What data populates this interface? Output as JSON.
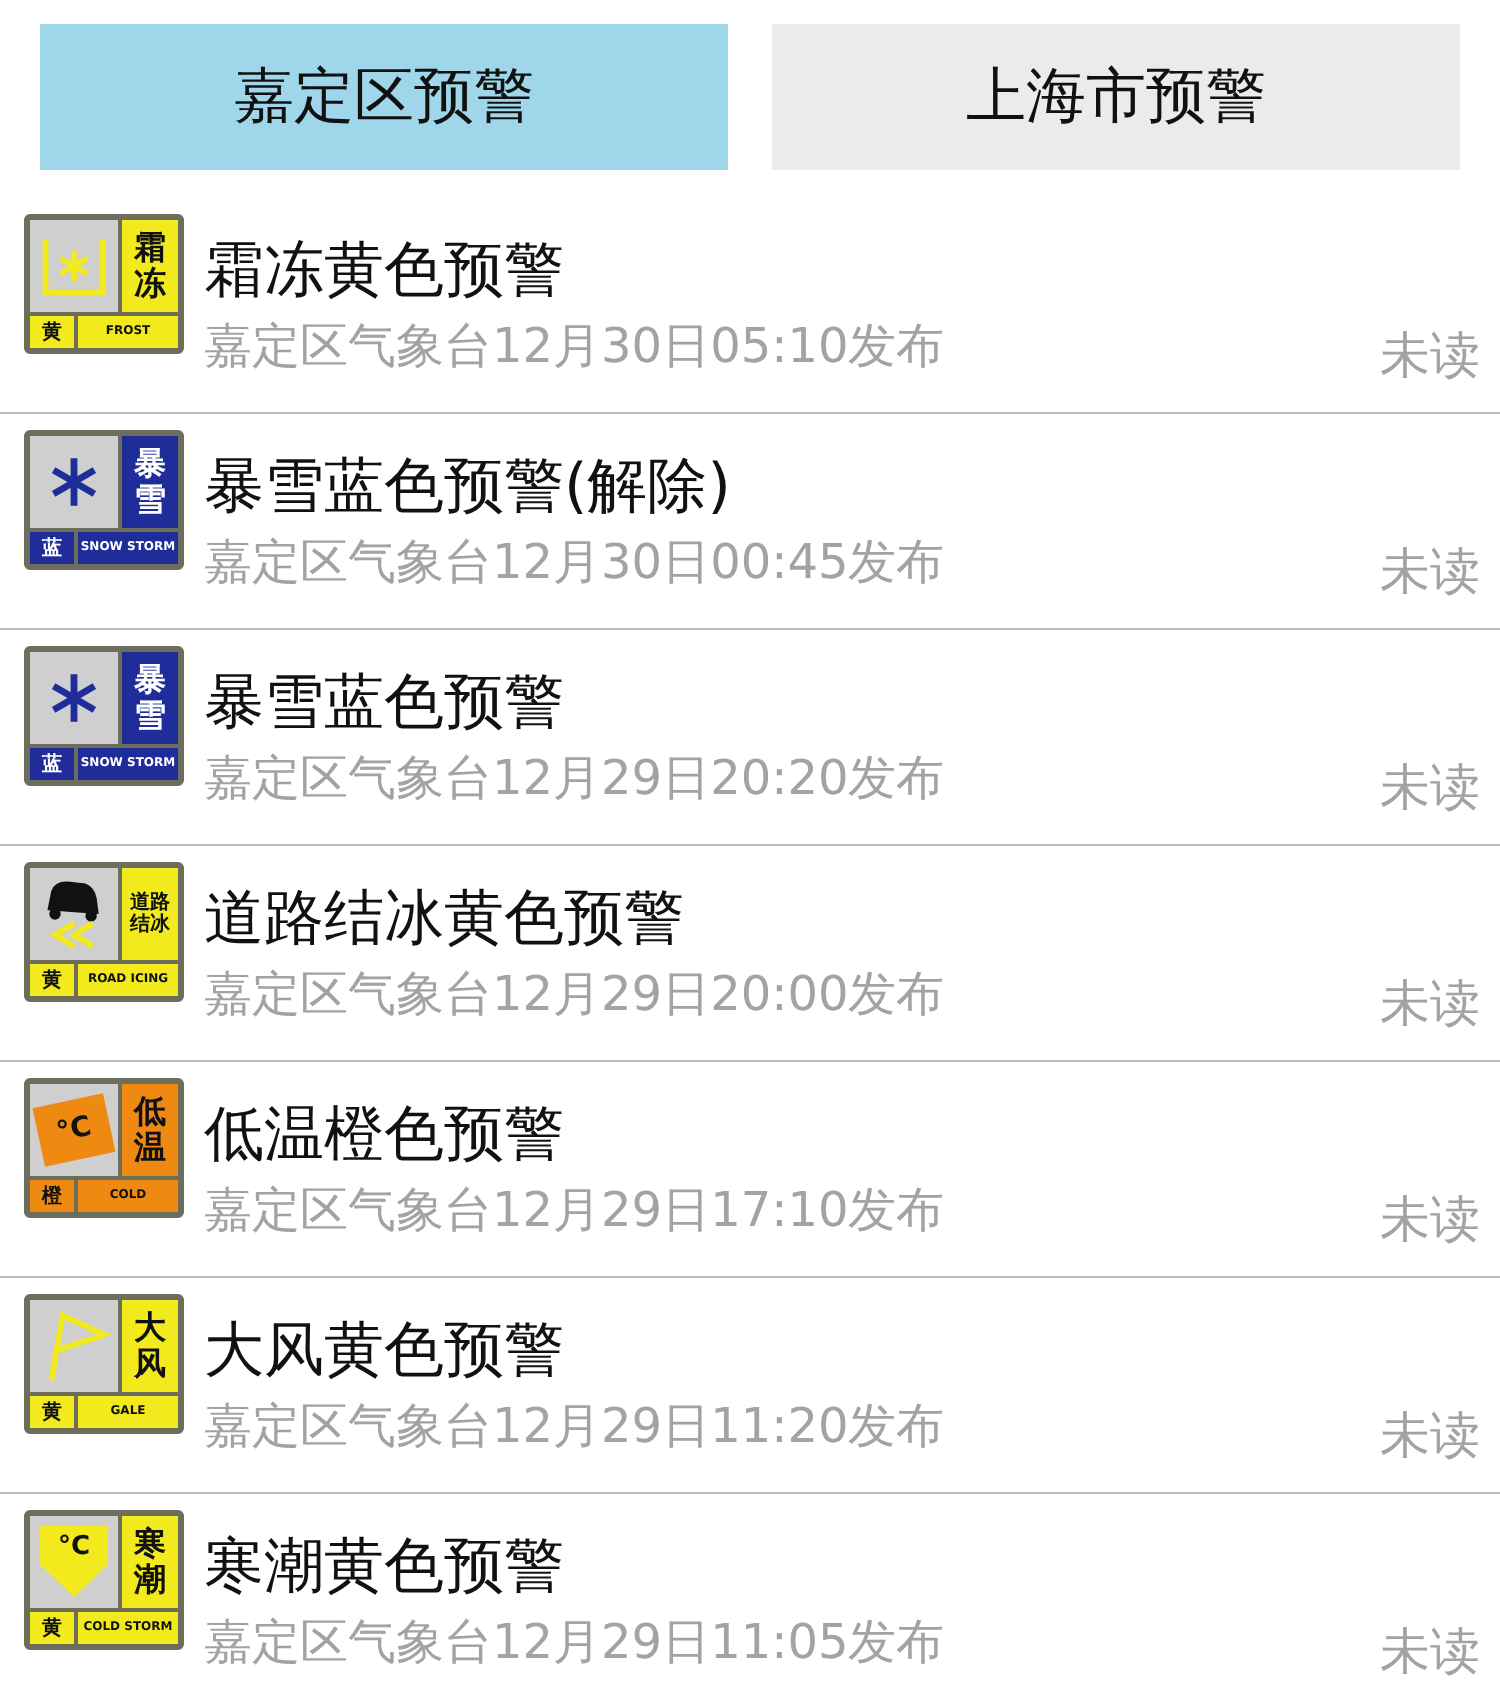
{
  "tabs": [
    {
      "label": "嘉定区预警",
      "selected": true
    },
    {
      "label": "上海市预警",
      "selected": false
    }
  ],
  "warnings": [
    {
      "title": "霜冻黄色预警",
      "source": "嘉定区气象台12月30日05:10发布",
      "status": "未读",
      "badge": {
        "kind": "frost",
        "color": "#f2ea1c",
        "name": "霜冻",
        "level": "黄",
        "english": "FROST"
      }
    },
    {
      "title": "暴雪蓝色预警(解除)",
      "source": "嘉定区气象台12月30日00:45发布",
      "status": "未读",
      "badge": {
        "kind": "snow",
        "color": "#1f2d9a",
        "name": "暴雪",
        "level": "蓝",
        "english": "SNOW STORM"
      }
    },
    {
      "title": "暴雪蓝色预警",
      "source": "嘉定区气象台12月29日20:20发布",
      "status": "未读",
      "badge": {
        "kind": "snow",
        "color": "#1f2d9a",
        "name": "暴雪",
        "level": "蓝",
        "english": "SNOW STORM"
      }
    },
    {
      "title": "道路结冰黄色预警",
      "source": "嘉定区气象台12月29日20:00发布",
      "status": "未读",
      "badge": {
        "kind": "road",
        "color": "#f2ea1c",
        "name": "道路结冰",
        "level": "黄",
        "english": "ROAD ICING"
      }
    },
    {
      "title": "低温橙色预警",
      "source": "嘉定区气象台12月29日17:10发布",
      "status": "未读",
      "badge": {
        "kind": "cold",
        "color": "#ee8a12",
        "name": "低温",
        "level": "橙",
        "english": "COLD",
        "symbol": "°C"
      }
    },
    {
      "title": "大风黄色预警",
      "source": "嘉定区气象台12月29日11:20发布",
      "status": "未读",
      "badge": {
        "kind": "gale",
        "color": "#f2ea1c",
        "name": "大风",
        "level": "黄",
        "english": "GALE"
      }
    },
    {
      "title": "寒潮黄色预警",
      "source": "嘉定区气象台12月29日11:05发布",
      "status": "未读",
      "badge": {
        "kind": "coldwave",
        "color": "#f2ea1c",
        "name": "寒潮",
        "level": "黄",
        "english": "COLD STORM",
        "symbol": "°C"
      }
    }
  ]
}
